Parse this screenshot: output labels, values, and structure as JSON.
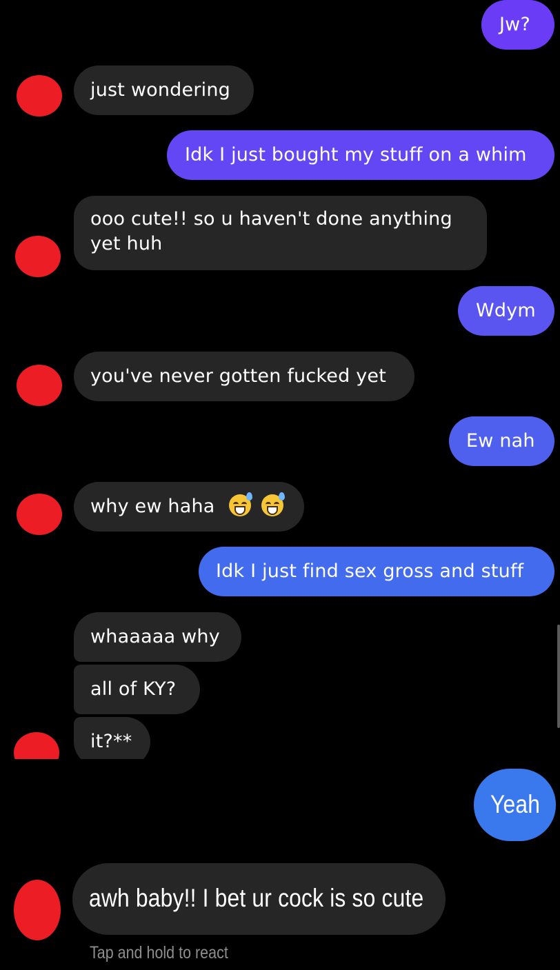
{
  "conversation": {
    "messages": [
      {
        "id": "m1",
        "direction": "outgoing",
        "text": "Jw?",
        "color": "#6a3cf5"
      },
      {
        "id": "m2",
        "direction": "incoming",
        "text": "just wondering"
      },
      {
        "id": "m3",
        "direction": "outgoing",
        "text": "Idk I just bought my stuff on a whim",
        "color": "#6447f4"
      },
      {
        "id": "m4",
        "direction": "incoming",
        "line1": "ooo cute!! so u haven't done anything",
        "line2": "yet huh"
      },
      {
        "id": "m5",
        "direction": "outgoing",
        "text": "Wdym",
        "color": "#5a55f0"
      },
      {
        "id": "m6",
        "direction": "incoming",
        "text": "you've never gotten fucked yet"
      },
      {
        "id": "m7",
        "direction": "outgoing",
        "text": "Ew nah",
        "color": "#4f60ee"
      },
      {
        "id": "m8",
        "direction": "incoming",
        "text": "why ew haha",
        "emoji": [
          "sweat-smile-emoji",
          "sweat-smile-emoji"
        ]
      },
      {
        "id": "m9",
        "direction": "outgoing",
        "text": "Idk I just find sex gross and stuff",
        "color": "#426ced"
      },
      {
        "id": "m10",
        "direction": "incoming",
        "text": "whaaaaa why"
      },
      {
        "id": "m11",
        "direction": "incoming",
        "text": "all of KY?"
      },
      {
        "id": "m12",
        "direction": "incoming",
        "text": "it?**"
      },
      {
        "id": "m13",
        "direction": "outgoing",
        "text": "Yeah",
        "color": "#3a78ee"
      },
      {
        "id": "m14",
        "direction": "incoming",
        "text": "awh baby!! I bet ur cock is so cute"
      }
    ],
    "hint": "Tap and hold to react",
    "colors": {
      "background": "#000000",
      "incoming_bubble": "#262626",
      "avatar": "#ec1d24"
    }
  }
}
